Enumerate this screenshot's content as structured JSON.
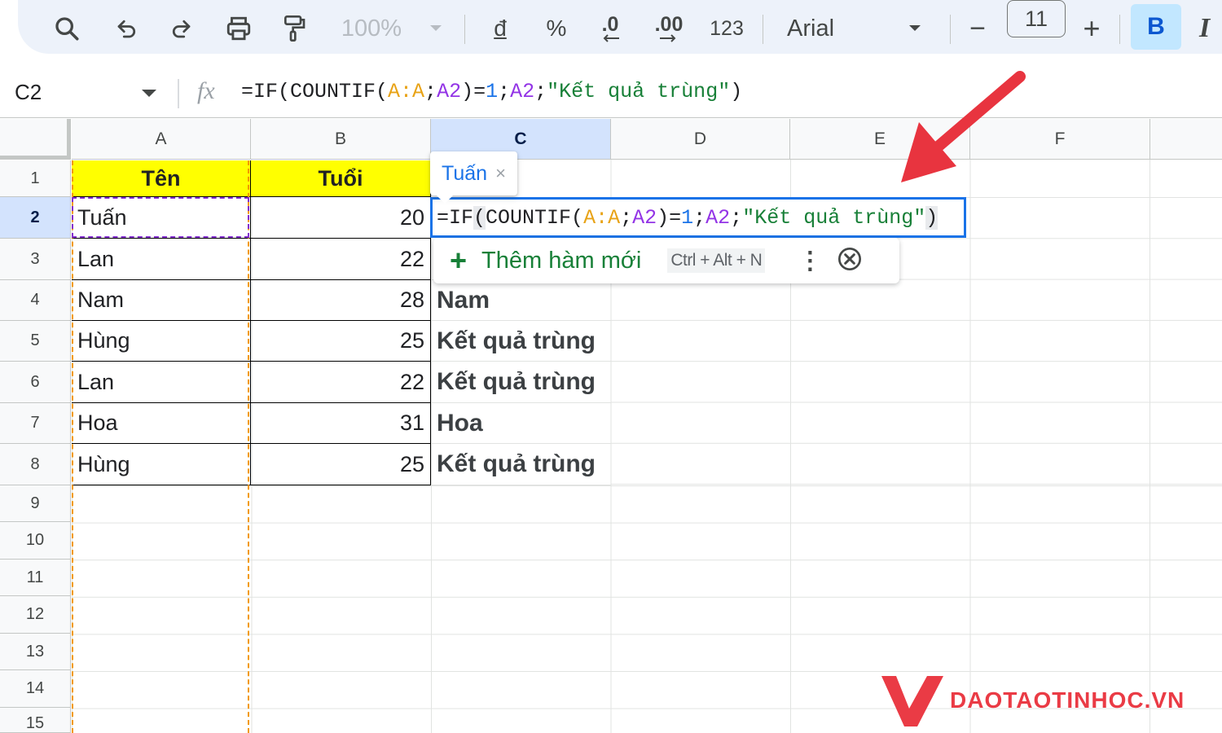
{
  "toolbar": {
    "zoom": "100%",
    "currency": "đ",
    "percent": "%",
    "decrease_decimal": ".0",
    "increase_decimal": ".00",
    "number_format": "123",
    "font": "Arial",
    "minus": "−",
    "font_size": "11",
    "plus": "+",
    "bold": "B",
    "italic": "I"
  },
  "formula_bar": {
    "name_box": "C2",
    "fx": "fx",
    "formula": {
      "t1": "=IF(COUNTIF(",
      "t2": "A:A",
      "t3": ";",
      "t4": "A2",
      "t5": ")=",
      "t6": "1",
      "t7": ";",
      "t8": "A2",
      "t9": ";",
      "t10": "\"Kết quả trùng\"",
      "t11": ")"
    }
  },
  "columns": [
    "A",
    "B",
    "C",
    "D",
    "E",
    "F"
  ],
  "rows": [
    "1",
    "2",
    "3",
    "4",
    "5",
    "6",
    "7",
    "8",
    "9",
    "10",
    "11",
    "12",
    "13",
    "14",
    "15"
  ],
  "sheet": {
    "header": {
      "name": "Tên",
      "age": "Tuổi"
    },
    "data": [
      {
        "name": "Tuấn",
        "age": "20",
        "result": ""
      },
      {
        "name": "Lan",
        "age": "22",
        "result": ""
      },
      {
        "name": "Nam",
        "age": "28",
        "result": "Nam"
      },
      {
        "name": "Hùng",
        "age": "25",
        "result": "Kết quả trùng"
      },
      {
        "name": "Lan",
        "age": "22",
        "result": "Kết quả trùng"
      },
      {
        "name": "Hoa",
        "age": "31",
        "result": "Hoa"
      },
      {
        "name": "Hùng",
        "age": "25",
        "result": "Kết quả trùng"
      }
    ]
  },
  "editor": {
    "t1": "=IF",
    "t1b": "(",
    "t2": "COUNTIF(",
    "t3": "A:A",
    "t4": ";",
    "t5": "A2",
    "t6": ")=",
    "t7": "1",
    "t8": ";",
    "t9": "A2",
    "t10": ";",
    "t11": "\"Kết quả trùng\"",
    "t12": ")"
  },
  "chip": {
    "value": "Tuấn",
    "close": "×"
  },
  "suggestion": {
    "plus": "+",
    "label": "Thêm hàm mới",
    "shortcut": "Ctrl + Alt + N",
    "more": "⋮"
  },
  "watermark": {
    "text": "DAOTAOTINHOC.VN"
  },
  "colors": {
    "accent_blue": "#1a73e8",
    "header_yellow": "#ffff00",
    "arrow_red": "#e8343f",
    "logo_red": "#ea3b45",
    "copy_orange": "#f29900"
  }
}
